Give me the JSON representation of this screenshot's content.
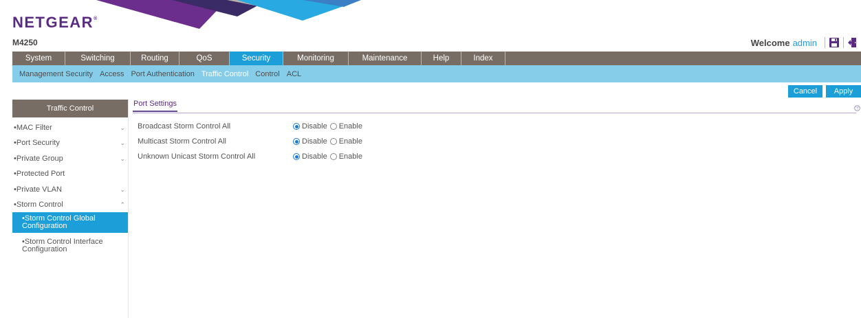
{
  "header": {
    "brand": "NETGEAR",
    "brand_mark": "®",
    "model": "M4250",
    "welcome_text": "Welcome",
    "username": "admin",
    "icons": [
      "save-icon",
      "logout-icon"
    ]
  },
  "main_nav": {
    "tabs": [
      {
        "label": "System"
      },
      {
        "label": "Switching"
      },
      {
        "label": "Routing"
      },
      {
        "label": "QoS"
      },
      {
        "label": "Security",
        "active": true
      },
      {
        "label": "Monitoring"
      },
      {
        "label": "Maintenance"
      },
      {
        "label": "Help"
      },
      {
        "label": "Index"
      }
    ]
  },
  "sub_nav": {
    "tabs": [
      {
        "label": "Management Security"
      },
      {
        "label": "Access"
      },
      {
        "label": "Port Authentication"
      },
      {
        "label": "Traffic Control",
        "active": true
      },
      {
        "label": "Control"
      },
      {
        "label": "ACL"
      }
    ]
  },
  "actions": {
    "cancel_label": "Cancel",
    "apply_label": "Apply"
  },
  "sidebar": {
    "title": "Traffic Control",
    "items": [
      {
        "label": "MAC Filter",
        "expandable": true,
        "expanded": false
      },
      {
        "label": "Port Security",
        "expandable": true,
        "expanded": false
      },
      {
        "label": "Private Group",
        "expandable": true,
        "expanded": false
      },
      {
        "label": "Protected Port",
        "expandable": false
      },
      {
        "label": "Private VLAN",
        "expandable": true,
        "expanded": false
      },
      {
        "label": "Storm Control",
        "expandable": true,
        "expanded": true
      }
    ],
    "sub_items": [
      {
        "label": "Storm Control Global Configuration",
        "active": true
      },
      {
        "label": "Storm Control Interface Configuration"
      }
    ]
  },
  "content": {
    "section_title": "Port Settings",
    "settings": [
      {
        "label": "Broadcast Storm Control All",
        "value": "Disable"
      },
      {
        "label": "Multicast Storm Control All",
        "value": "Disable"
      },
      {
        "label": "Unknown Unicast Storm Control All",
        "value": "Disable"
      }
    ],
    "options": [
      "Disable",
      "Enable"
    ]
  },
  "colors": {
    "brand_purple": "#5a2b82",
    "nav_gray": "#776d65",
    "accent_blue": "#1c9fd8",
    "subnav_blue": "#86cde9"
  }
}
